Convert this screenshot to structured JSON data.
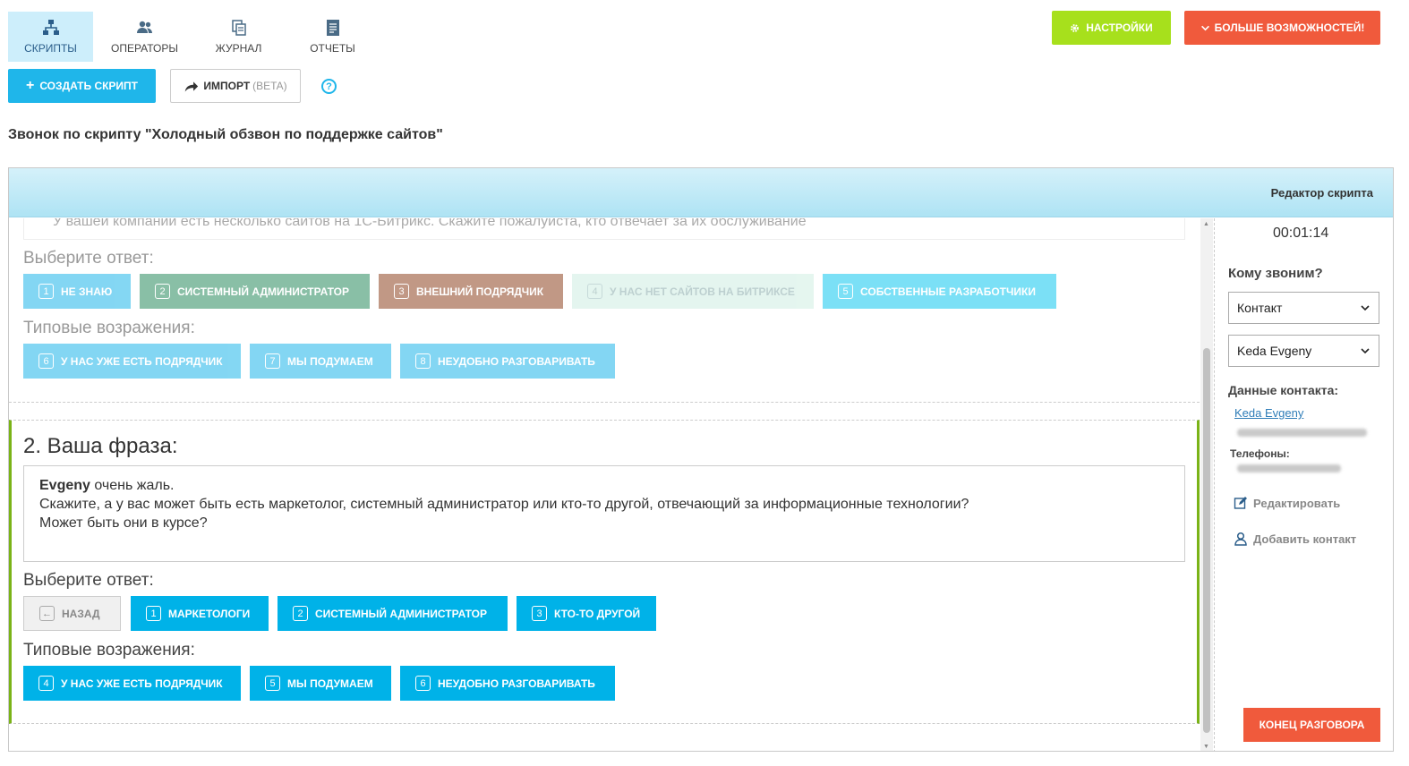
{
  "nav": {
    "tabs": [
      {
        "label": "СКРИПТЫ",
        "icon": "sitemap-icon",
        "active": true
      },
      {
        "label": "ОПЕРАТОРЫ",
        "icon": "users-icon",
        "active": false
      },
      {
        "label": "ЖУРНАЛ",
        "icon": "copy-icon",
        "active": false
      },
      {
        "label": "ОТЧЕТЫ",
        "icon": "document-icon",
        "active": false
      }
    ]
  },
  "header": {
    "settings_label": "НАСТРОЙКИ",
    "more_label": "БОЛЬШЕ ВОЗМОЖНОСТЕЙ!"
  },
  "toolbar": {
    "create_label": "СОЗДАТЬ СКРИПТ",
    "import_label": "ИМПОРТ",
    "import_beta": "(BETA)",
    "help": "?"
  },
  "page_title": "Звонок по скрипту \"Холодный обзвон по поддержке сайтов\"",
  "panel": {
    "editor_link": "Редактор скрипта"
  },
  "prev_step": {
    "text": "У вашей компании есть несколько сайтов на 1С-Битрикс. Скажите пожалуйста, кто отвечает за их обслуживание",
    "choose_label": "Выберите ответ:",
    "objections_label": "Типовые возражения:",
    "answers": [
      {
        "num": "1",
        "label": "НЕ ЗНАЮ",
        "color": "#1fb6ea"
      },
      {
        "num": "2",
        "label": "СИСТЕМНЫЙ АДМИНИСТРАТОР",
        "color": "#2a8c5e"
      },
      {
        "num": "3",
        "label": "ВНЕШНИЙ ПОДРЯДЧИК",
        "color": "#8f4422"
      },
      {
        "num": "4",
        "label": "У НАС НЕТ САЙТОВ НА БИТРИКСЕ",
        "color": "#cfeee2"
      },
      {
        "num": "5",
        "label": "СОБСТВЕННЫЕ РАЗРАБОТЧИКИ",
        "color": "#10c8f0"
      }
    ],
    "objections": [
      {
        "num": "6",
        "label": "У НАС УЖЕ ЕСТЬ ПОДРЯДЧИК"
      },
      {
        "num": "7",
        "label": "МЫ ПОДУМАЕМ"
      },
      {
        "num": "8",
        "label": "НЕУДОБНО РАЗГОВАРИВАТЬ"
      }
    ]
  },
  "current_step": {
    "title": "2. Ваша фраза:",
    "phrase_name": "Evgeny",
    "phrase_line1": " очень жаль.",
    "phrase_line2": "Скажите, а у вас может быть есть маркетолог, системный администратор или кто-то другой, отвечающий за информационные технологии?",
    "phrase_line3": "Может быть они в курсе?",
    "choose_label": "Выберите ответ:",
    "objections_label": "Типовые возражения:",
    "back_label": "НАЗАД",
    "answers": [
      {
        "num": "1",
        "label": "МАРКЕТОЛОГИ"
      },
      {
        "num": "2",
        "label": "СИСТЕМНЫЙ АДМИНИСТРАТОР"
      },
      {
        "num": "3",
        "label": "КТО-ТО ДРУГОЙ"
      }
    ],
    "objections": [
      {
        "num": "4",
        "label": "У НАС УЖЕ ЕСТЬ ПОДРЯДЧИК"
      },
      {
        "num": "5",
        "label": "МЫ ПОДУМАЕМ"
      },
      {
        "num": "6",
        "label": "НЕУДОБНО РАЗГОВАРИВАТЬ"
      }
    ],
    "accent": "#00b2e8"
  },
  "sidebar": {
    "timer": "00:01:14",
    "who_label": "Кому звоним?",
    "select_type": "Контакт",
    "select_contact": "Keda Evgeny",
    "contact_data_label": "Данные контакта:",
    "contact_link": "Keda Evgeny",
    "phones_label": "Телефоны:",
    "edit_label": "Редактировать",
    "add_contact_label": "Добавить контакт",
    "end_call_label": "КОНЕЦ РАЗГОВОРА"
  }
}
